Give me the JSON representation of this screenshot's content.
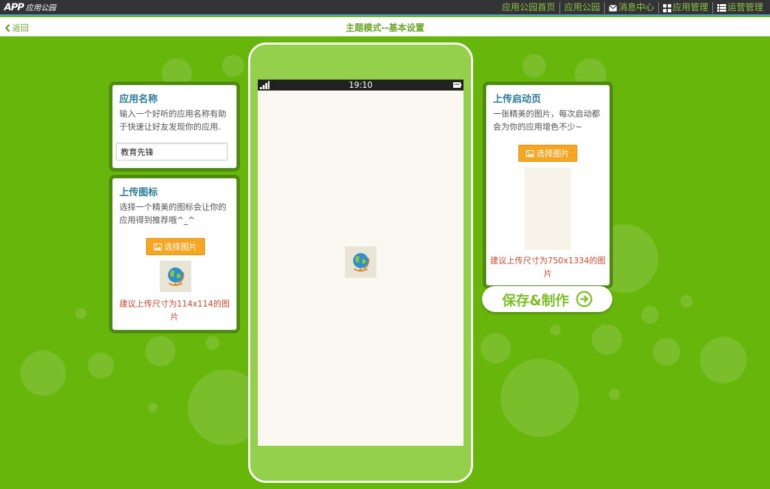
{
  "header": {
    "logo_mark": "APP",
    "logo_text": "应用公园",
    "nav": [
      {
        "label": "应用公园首页",
        "icon": ""
      },
      {
        "label": "应用公园",
        "icon": ""
      },
      {
        "label": "消息中心",
        "icon": "envelope-icon"
      },
      {
        "label": "应用管理",
        "icon": "grid-icon"
      },
      {
        "label": "运营管理",
        "icon": "list-icon"
      }
    ]
  },
  "subheader": {
    "back_label": "返回",
    "title": "主题模式--基本设置"
  },
  "app_name_card": {
    "title": "应用名称",
    "desc": "输入一个好听的应用名称有助于快速让好友发现你的应用.",
    "input_value": "教育先锋"
  },
  "icon_card": {
    "title": "上传图标",
    "desc": "选择一个精美的图标会让你的应用得到推荐哦^_^",
    "button": "选择图片",
    "hint": "建议上传尺寸为114x114的图片"
  },
  "phone": {
    "time": "19:10"
  },
  "splash_card": {
    "title": "上传启动页",
    "desc": "一张精美的图片，每次启动都会为你的应用增色不少~",
    "button": "选择图片",
    "hint": "建议上传尺寸为750x1334的图片"
  },
  "save_button": "保存&制作",
  "colors": {
    "background": "#67b60c",
    "nav_text": "#8cc63f",
    "title_blue": "#2c7a98",
    "button_orange": "#f5a623",
    "hint_red": "#d24c2f"
  }
}
